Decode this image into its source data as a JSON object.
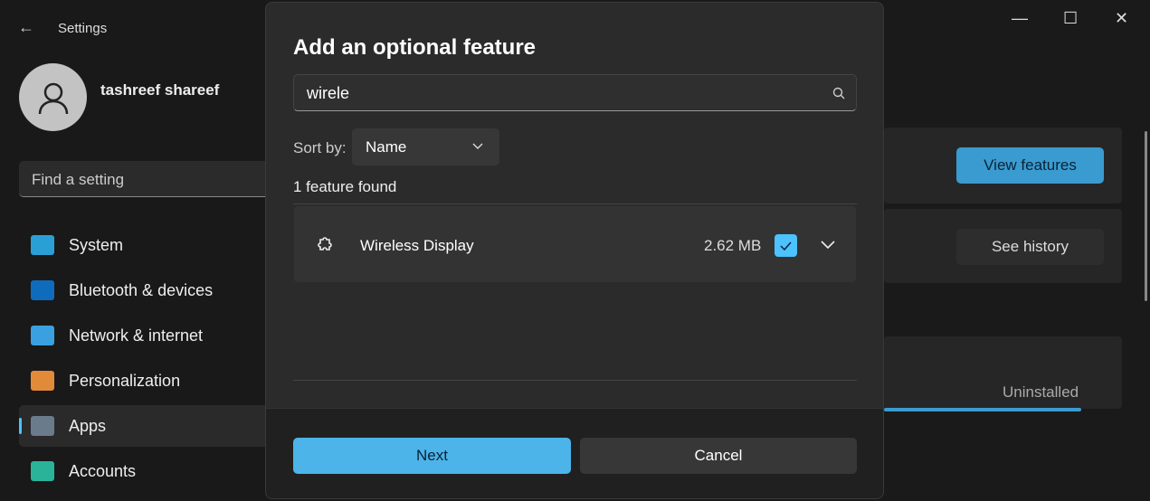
{
  "app": {
    "title": "Settings",
    "back_icon": "arrow-left-icon"
  },
  "user": {
    "name": "tashreef shareef",
    "avatar_icon": "person-icon"
  },
  "search": {
    "placeholder": "Find a setting"
  },
  "nav": [
    {
      "label": "System",
      "icon": "monitor-icon",
      "color": "#2a9fd6"
    },
    {
      "label": "Bluetooth & devices",
      "icon": "bluetooth-icon",
      "color": "#0f6cbd"
    },
    {
      "label": "Network & internet",
      "icon": "wifi-icon",
      "color": "#3aa0e0"
    },
    {
      "label": "Personalization",
      "icon": "brush-icon",
      "color": "#e08a3a"
    },
    {
      "label": "Apps",
      "icon": "apps-icon",
      "color": "#6a7b8c",
      "selected": true
    },
    {
      "label": "Accounts",
      "icon": "account-icon",
      "color": "#2bb39a"
    }
  ],
  "window": {
    "minimize": "—",
    "maximize": "☐",
    "close": "✕"
  },
  "background": {
    "view_features": "View features",
    "see_history": "See history",
    "status": "Uninstalled",
    "progress_percent": 100
  },
  "dialog": {
    "title": "Add an optional feature",
    "search_value": "wirele",
    "sort_label": "Sort by:",
    "sort_value": "Name",
    "found_text": "1 feature found",
    "features": [
      {
        "name": "Wireless Display",
        "size": "2.62 MB",
        "checked": true,
        "icon": "puzzle-icon"
      }
    ],
    "next": "Next",
    "cancel": "Cancel"
  },
  "colors": {
    "accent": "#4cc2ff",
    "button_accent": "#3a9bd0"
  }
}
